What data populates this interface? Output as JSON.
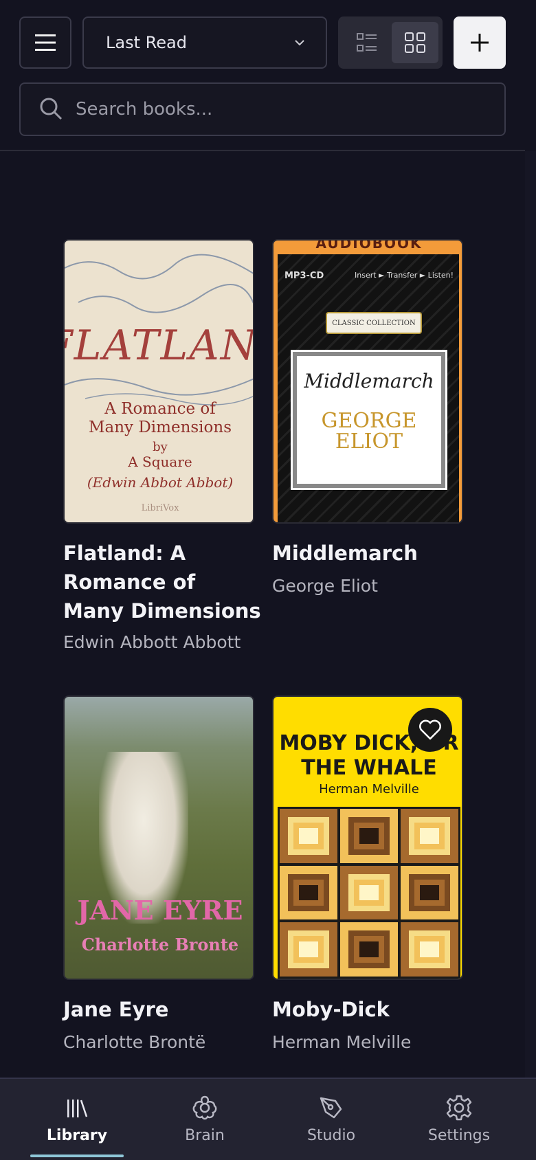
{
  "toolbar": {
    "sort_value": "Last Read",
    "search_placeholder": "Search books...",
    "view_mode": "grid"
  },
  "books": [
    {
      "title": "Flatland: A Romance of Many Dimensions",
      "author": "Edwin Abbott Abbott",
      "favorite": false,
      "cover": {
        "title": "FLATLAND",
        "subtitle_1": "A Romance of",
        "subtitle_2": "Many Dimensions",
        "by": "by",
        "square": "A Square",
        "name": "(Edwin Abbot Abbot)",
        "publisher": "LibriVox"
      }
    },
    {
      "title": "Middlemarch",
      "author": "George Eliot",
      "favorite": false,
      "cover": {
        "top": "AUDIOBOOK",
        "cd": "MP3-CD",
        "steps": "Insert ► Transfer ► Listen!",
        "banner": "CLASSIC COLLECTION",
        "title": "Middlemarch",
        "author_1": "GEORGE",
        "author_2": "ELIOT"
      }
    },
    {
      "title": "Jane Eyre",
      "author": "Charlotte Brontë",
      "favorite": false,
      "cover": {
        "title": "JANE EYRE",
        "author": "Charlotte Bronte"
      }
    },
    {
      "title": "Moby-Dick",
      "author": "Herman Melville",
      "favorite": true,
      "cover": {
        "title_1": "MOBY DICK; OR",
        "title_2": "THE WHALE",
        "author": "Herman Melville"
      }
    }
  ],
  "nav": {
    "items": [
      {
        "label": "Library",
        "icon": "library-icon",
        "active": true
      },
      {
        "label": "Brain",
        "icon": "brain-icon",
        "active": false
      },
      {
        "label": "Studio",
        "icon": "studio-icon",
        "active": false
      },
      {
        "label": "Settings",
        "icon": "gear-icon",
        "active": false
      }
    ]
  },
  "colors": {
    "background": "#131320",
    "accent": "#8fc7d8",
    "nav_bg": "#232331"
  }
}
